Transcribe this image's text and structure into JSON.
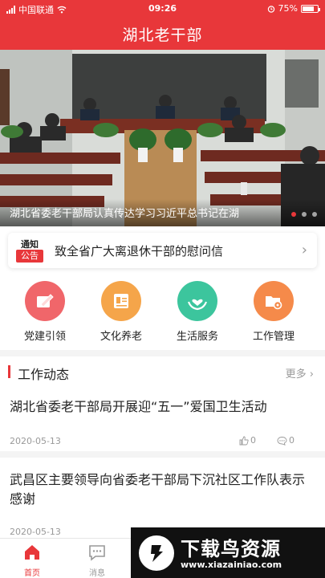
{
  "status_bar": {
    "carrier": "中国联通",
    "time": "09:26",
    "battery": "75%",
    "battery_level": 0.75
  },
  "header": {
    "title": "湖北老干部"
  },
  "banner": {
    "caption": "湖北省委老干部局认真传达学习习近平总书记在湖",
    "slides": 3,
    "active_index": 0
  },
  "notice": {
    "badge_top": "通知",
    "badge_bottom": "公告",
    "text": "致全省广大离退休干部的慰问信"
  },
  "quick_entries": [
    {
      "label": "党建引领",
      "icon": "party-building-icon",
      "color": "#f0666a"
    },
    {
      "label": "文化养老",
      "icon": "culture-card-icon",
      "color": "#f5a54a"
    },
    {
      "label": "生活服务",
      "icon": "heart-hands-icon",
      "color": "#3cc59d"
    },
    {
      "label": "工作管理",
      "icon": "folder-gear-icon",
      "color": "#f58a4a"
    }
  ],
  "section": {
    "title": "工作动态",
    "more": "更多"
  },
  "news": [
    {
      "title": "湖北省委老干部局开展迎“五一”爱国卫生活动",
      "date": "2020-05-13",
      "likes": "0",
      "comments": "0"
    },
    {
      "title": "武昌区主要领导向省委老干部局下沉社区工作队表示感谢",
      "date": "2020-05-13",
      "likes": "",
      "comments": ""
    }
  ],
  "bottom_nav": [
    {
      "label": "首页",
      "icon": "home-icon",
      "active": true
    },
    {
      "label": "消息",
      "icon": "message-icon",
      "active": false
    }
  ],
  "watermark": {
    "title": "下载鸟资源",
    "url": "www.xiazainiao.com"
  },
  "colors": {
    "brand": "#e8373a",
    "muted": "#999999"
  }
}
